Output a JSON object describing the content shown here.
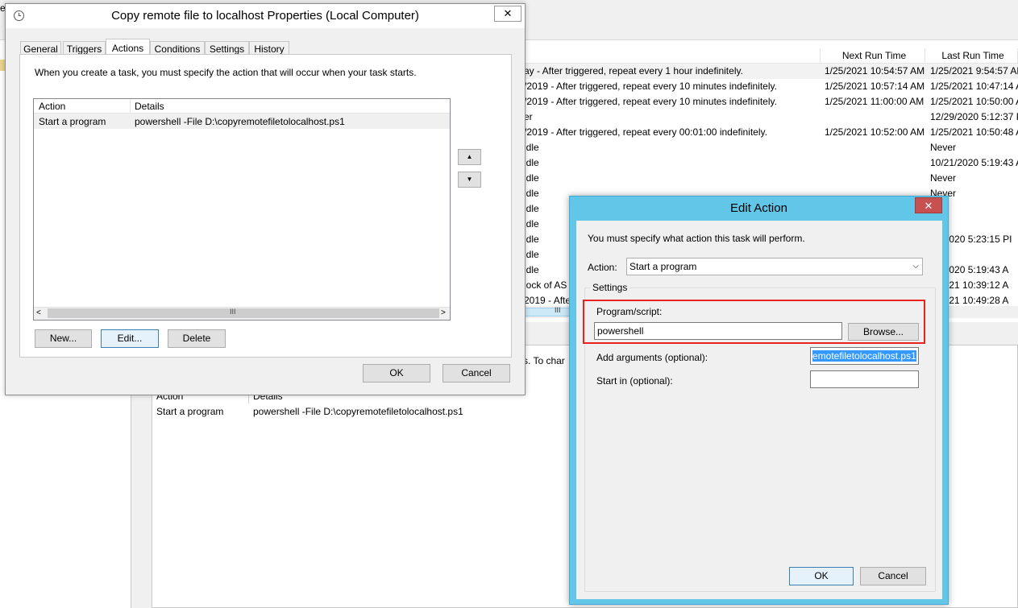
{
  "background": {
    "columns": {
      "next_run_time": "Next Run Time",
      "last_run_time": "Last Run Time"
    },
    "rows": [
      {
        "trigger": "ay - After triggered, repeat every 1 hour indefinitely.",
        "next": "1/25/2021 10:54:57 AM",
        "last": "1/25/2021 9:54:57 AM"
      },
      {
        "trigger": "/2019 - After triggered, repeat every 10 minutes indefinitely.",
        "next": "1/25/2021 10:57:14 AM",
        "last": "1/25/2021 10:47:14 A"
      },
      {
        "trigger": "/2019 - After triggered, repeat every 10 minutes indefinitely.",
        "next": "1/25/2021 11:00:00 AM",
        "last": "1/25/2021 10:50:00 A"
      },
      {
        "trigger": "er",
        "next": "",
        "last": "12/29/2020 5:12:37 PI"
      },
      {
        "trigger": "/2019 - After triggered, repeat every 00:01:00 indefinitely.",
        "next": "1/25/2021 10:52:00 AM",
        "last": "1/25/2021 10:50:48 A"
      },
      {
        "trigger": "idle",
        "next": "",
        "last": "Never"
      },
      {
        "trigger": "idle",
        "next": "",
        "last": "10/21/2020 5:19:43 A"
      },
      {
        "trigger": "idle",
        "next": "",
        "last": "Never"
      },
      {
        "trigger": "idle",
        "next": "",
        "last": "Never"
      },
      {
        "trigger": "idle",
        "next": "",
        "last": "er"
      },
      {
        "trigger": "idle",
        "next": "",
        "last": "er"
      },
      {
        "trigger": "idle",
        "next": "",
        "last": "29/2020 5:23:15 PI"
      },
      {
        "trigger": "idle",
        "next": "",
        "last": "er"
      },
      {
        "trigger": "idle",
        "next": "",
        "last": "21/2020 5:19:43 A"
      },
      {
        "trigger": "lock of AS",
        "next": "",
        "last": "5/2021 10:39:12 A"
      },
      {
        "trigger": "2019 - Afte",
        "next": "",
        "last": "5/2021 10:49:28 A"
      }
    ],
    "left_edge_char": "e",
    "partial_text": "s.  To char",
    "lower_panel": {
      "col_action": "Action",
      "col_details": "Details",
      "row_action": "Start a program",
      "row_details": "powershell -File D:\\copyremotefiletolocalhost.ps1"
    }
  },
  "properties_dialog": {
    "title": "Copy remote file to localhost Properties (Local Computer)",
    "close_glyph": "✕",
    "tabs": [
      "General",
      "Triggers",
      "Actions",
      "Conditions",
      "Settings",
      "History"
    ],
    "selected_tab": "Actions",
    "description": "When you create a task, you must specify the action that will occur when your task starts.",
    "table": {
      "col_action": "Action",
      "col_details": "Details",
      "rows": [
        {
          "action": "Start a program",
          "details": "powershell -File D:\\copyremotefiletolocalhost.ps1"
        }
      ]
    },
    "buttons": {
      "new": "New...",
      "edit": "Edit...",
      "delete": "Delete",
      "ok": "OK",
      "cancel": "Cancel"
    }
  },
  "edit_action_dialog": {
    "title": "Edit Action",
    "close_glyph": "✕",
    "description": "You must specify what action this task will perform.",
    "action_label": "Action:",
    "action_value": "Start a program",
    "settings_label": "Settings",
    "program_label": "Program/script:",
    "program_value": "powershell",
    "browse_label": "Browse...",
    "arguments_label": "Add arguments (optional):",
    "arguments_value": "emotefiletolocalhost.ps1",
    "start_in_label": "Start in (optional):",
    "start_in_value": "",
    "ok_label": "OK",
    "cancel_label": "Cancel",
    "highlight_color": "#e8231f"
  }
}
